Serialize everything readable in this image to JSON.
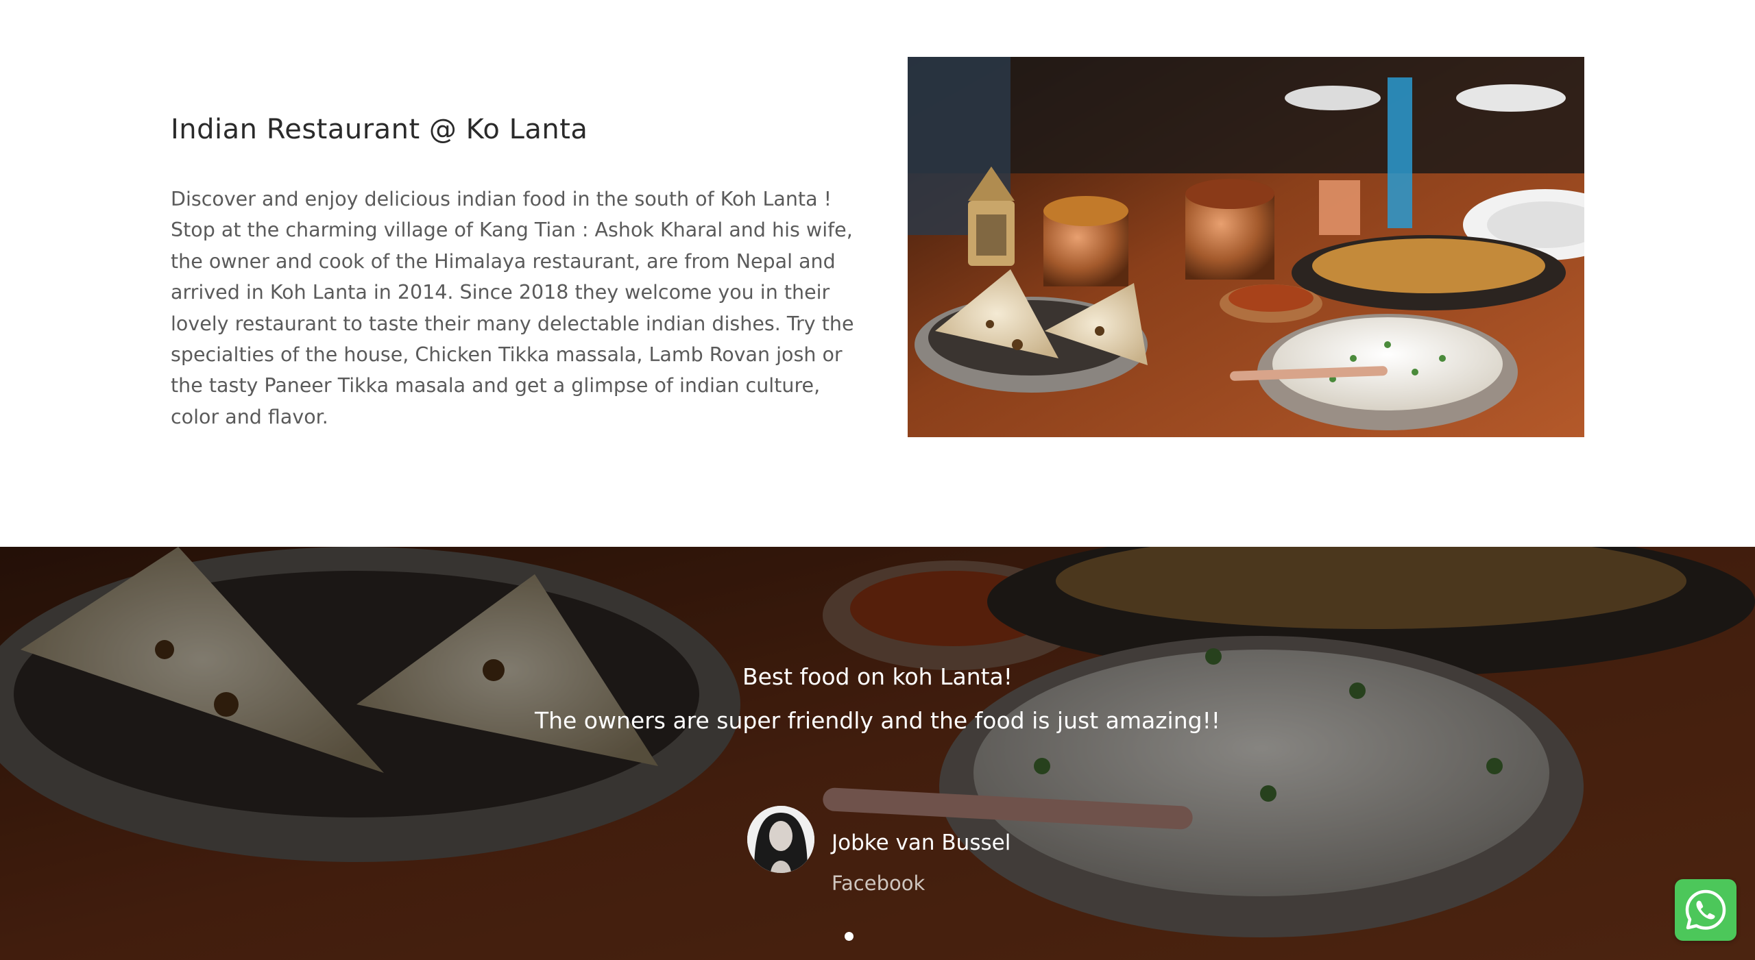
{
  "about": {
    "title": "Indian Restaurant @ Ko Lanta",
    "description": "Discover and enjoy delicious indian food in the south of Koh Lanta ! Stop at the charming village of Kang Tian : Ashok Kharal and his wife, the owner and cook of the Himalaya restaurant, are from Nepal and arrived in Koh Lanta in 2014. Since 2018 they welcome you in their lovely restaurant to taste their many delectable indian dishes. Try the specialties of the house, Chicken Tikka massala, Lamb  Rovan josh or the tasty Paneer Tikka masala and get a glimpse of indian culture, color and flavor."
  },
  "testimonial": {
    "quote_line_1": "Best food on koh Lanta!",
    "quote_line_2": "The owners are super friendly and the food is just amazing!!",
    "author_name": "Jobke van Bussel",
    "author_source": "Facebook",
    "slides_total": 1,
    "active_slide": 1
  },
  "icons": {
    "whatsapp": "whatsapp-icon"
  },
  "colors": {
    "whatsapp_green": "#4cc75a",
    "heading": "#2a2a2a",
    "body_text": "#5a5a5a"
  }
}
